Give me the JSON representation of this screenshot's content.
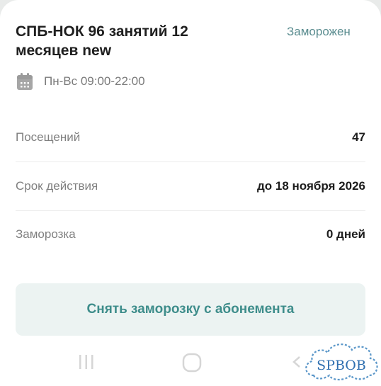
{
  "subscription": {
    "title": "СПБ-НОК 96 занятий 12 месяцев new",
    "status": "Заморожен",
    "schedule": "Пн-Вс 09:00-22:00"
  },
  "details": [
    {
      "label": "Посещений",
      "value": "47"
    },
    {
      "label": "Срок действия",
      "value": "до 18 ноября 2026"
    },
    {
      "label": "Заморозка",
      "value": "0 дней"
    }
  ],
  "action": {
    "label": "Снять заморозку с абонемента"
  },
  "colors": {
    "accent": "#3e8d8b",
    "status": "#5b8d90",
    "button_bg": "#ecf3f2"
  },
  "icons": [
    "calendar-icon",
    "recent-apps-icon",
    "home-icon",
    "back-icon"
  ],
  "watermark": "SPBOB"
}
